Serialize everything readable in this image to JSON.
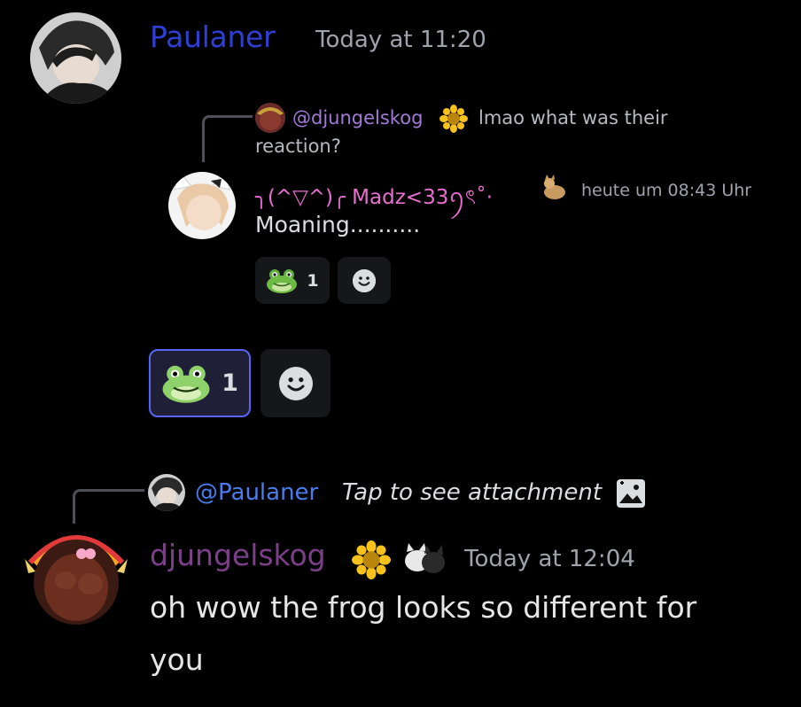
{
  "message1": {
    "author": "Paulaner",
    "timestamp": "Today at 11:20",
    "embed": {
      "reply_ref": {
        "author": "@djungelskog",
        "text_line1": "lmao what was their",
        "text_line2": "reaction?"
      },
      "author": "╮(^▽^)╭ Madz<33ꪆৎ˚⋅",
      "timestamp": "heute um 08:43 Uhr",
      "text": "Moaning..........",
      "reactions": [
        {
          "emoji": "frog-emoji",
          "count": "1"
        }
      ]
    },
    "reactions": [
      {
        "emoji": "frog-emoji",
        "count": "1",
        "active": true
      }
    ]
  },
  "message2": {
    "reply": {
      "author": "@Paulaner",
      "text": "Tap to see attachment"
    },
    "author": "djungelskog",
    "timestamp": "Today at 12:04",
    "text_line1": "oh wow the frog looks so different for",
    "text_line2": "you"
  },
  "colors": {
    "background": "#000000",
    "paulaner_name": "#2f3fd6",
    "djungelskog_name": "#7b3f88",
    "mention_link": "#4b7bec",
    "reaction_active_border": "#5865f2"
  }
}
